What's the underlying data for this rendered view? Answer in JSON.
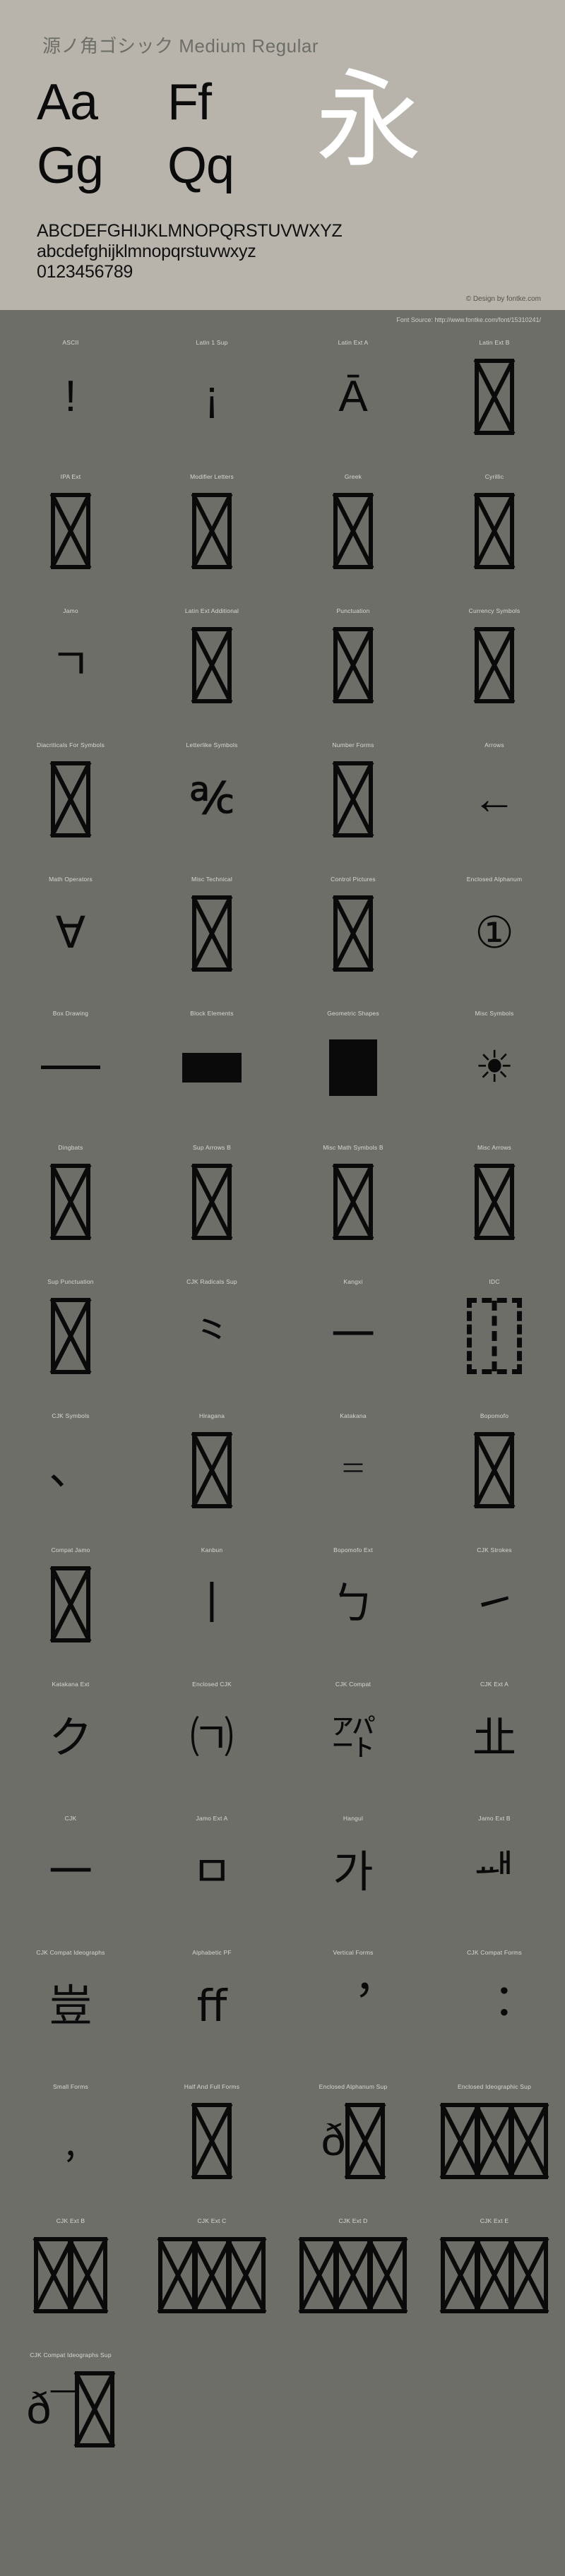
{
  "specimen": {
    "title": "源ノ角ゴシック Medium Regular",
    "samples": [
      {
        "upper": "Aa",
        "lower": "Gg"
      },
      {
        "upper": "Ff",
        "lower": "Qq"
      }
    ],
    "cjk_sample": "永",
    "uppercase": "ABCDEFGHIJKLMNOPQRSTUVWXYZ",
    "lowercase": "abcdefghijklmnopqrstuvwxyz",
    "digits": "0123456789",
    "credit": "© Design by fontke.com",
    "source": "Font Source: http://www.fontke.com/font/15310241/",
    "colors": {
      "panel_bg": "#b8b4ab",
      "page_bg": "#6e6e69",
      "glyph_black": "#0a0a0a",
      "glyph_white": "#ffffff",
      "label_grey": "#d9d7d2"
    }
  },
  "blocks": [
    [
      {
        "label": "ASCII",
        "glyph": "!",
        "kind": "text"
      },
      {
        "label": "Latin 1 Sup",
        "glyph": "¡",
        "kind": "text"
      },
      {
        "label": "Latin Ext A",
        "glyph": "Ā",
        "kind": "text"
      },
      {
        "label": "Latin Ext B",
        "glyph": "",
        "kind": "notdef"
      }
    ],
    [
      {
        "label": "IPA Ext",
        "glyph": "",
        "kind": "notdef"
      },
      {
        "label": "Modifier Letters",
        "glyph": "",
        "kind": "notdef"
      },
      {
        "label": "Greek",
        "glyph": "",
        "kind": "notdef"
      },
      {
        "label": "Cyrillic",
        "glyph": "",
        "kind": "notdef"
      }
    ],
    [
      {
        "label": "Jamo",
        "glyph": "ㄱ",
        "kind": "text"
      },
      {
        "label": "Latin Ext Additional",
        "glyph": "",
        "kind": "notdef"
      },
      {
        "label": "Punctuation",
        "glyph": "",
        "kind": "notdef"
      },
      {
        "label": "Currency Symbols",
        "glyph": "",
        "kind": "notdef"
      }
    ],
    [
      {
        "label": "Diacriticals For Symbols",
        "glyph": "",
        "kind": "notdef"
      },
      {
        "label": "Letterlike Symbols",
        "glyph": "℀",
        "kind": "text"
      },
      {
        "label": "Number Forms",
        "glyph": "",
        "kind": "notdef"
      },
      {
        "label": "Arrows",
        "glyph": "←",
        "kind": "text"
      }
    ],
    [
      {
        "label": "Math Operators",
        "glyph": "∀",
        "kind": "text"
      },
      {
        "label": "Misc Technical",
        "glyph": "",
        "kind": "notdef"
      },
      {
        "label": "Control Pictures",
        "glyph": "",
        "kind": "notdef"
      },
      {
        "label": "Enclosed Alphanum",
        "glyph": "①",
        "kind": "text"
      }
    ],
    [
      {
        "label": "Box Drawing",
        "glyph": "─",
        "kind": "boxline"
      },
      {
        "label": "Block Elements",
        "glyph": "▀",
        "kind": "blockrect"
      },
      {
        "label": "Geometric Shapes",
        "glyph": "▮",
        "kind": "georect"
      },
      {
        "label": "Misc Symbols",
        "glyph": "☀",
        "kind": "text"
      }
    ],
    [
      {
        "label": "Dingbats",
        "glyph": "",
        "kind": "notdef"
      },
      {
        "label": "Sup Arrows B",
        "glyph": "",
        "kind": "notdef"
      },
      {
        "label": "Misc Math Symbols B",
        "glyph": "",
        "kind": "notdef"
      },
      {
        "label": "Misc Arrows",
        "glyph": "",
        "kind": "notdef"
      }
    ],
    [
      {
        "label": "Sup Punctuation",
        "glyph": "",
        "kind": "notdef"
      },
      {
        "label": "CJK Radicals Sup",
        "glyph": "⺀",
        "kind": "text"
      },
      {
        "label": "Kangxi",
        "glyph": "一",
        "kind": "text"
      },
      {
        "label": "IDC",
        "glyph": "",
        "kind": "notdef-dashed"
      }
    ],
    [
      {
        "label": "CJK Symbols",
        "glyph": "、",
        "kind": "text"
      },
      {
        "label": "Hiragana",
        "glyph": "",
        "kind": "notdef"
      },
      {
        "label": "Katakana",
        "glyph": "゠",
        "kind": "text"
      },
      {
        "label": "Bopomofo",
        "glyph": "",
        "kind": "notdef"
      }
    ],
    [
      {
        "label": "Compat Jamo",
        "glyph": "",
        "kind": "notdef"
      },
      {
        "label": "Kanbun",
        "glyph": "丨",
        "kind": "text"
      },
      {
        "label": "Bopomofo Ext",
        "glyph": "ㄅ",
        "kind": "text"
      },
      {
        "label": "CJK Strokes",
        "glyph": "㇀",
        "kind": "text"
      }
    ],
    [
      {
        "label": "Katakana Ext",
        "glyph": "ク",
        "kind": "text"
      },
      {
        "label": "Enclosed CJK",
        "glyph": "㈀",
        "kind": "text"
      },
      {
        "label": "CJK Compat",
        "glyph": "㌀",
        "kind": "text"
      },
      {
        "label": "CJK Ext A",
        "glyph": "㐀",
        "kind": "text"
      }
    ],
    [
      {
        "label": "CJK",
        "glyph": "一",
        "kind": "text"
      },
      {
        "label": "Jamo Ext A",
        "glyph": "ㅁ",
        "kind": "text"
      },
      {
        "label": "Hangul",
        "glyph": "가",
        "kind": "text"
      },
      {
        "label": "Jamo Ext B",
        "glyph": "ힳ",
        "kind": "text"
      }
    ],
    [
      {
        "label": "CJK Compat Ideographs",
        "glyph": "豈",
        "kind": "text"
      },
      {
        "label": "Alphabetic PF",
        "glyph": "ﬀ",
        "kind": "text"
      },
      {
        "label": "Vertical Forms",
        "glyph": "︐",
        "kind": "text"
      },
      {
        "label": "CJK Compat Forms",
        "glyph": "︓",
        "kind": "text"
      }
    ],
    [
      {
        "label": "Small Forms",
        "glyph": "﹐",
        "kind": "text"
      },
      {
        "label": "Half And Full Forms",
        "glyph": "",
        "kind": "notdef"
      },
      {
        "label": "Enclosed Alphanum Sup",
        "glyph": "🄀",
        "kind": "surrogate1"
      },
      {
        "label": "Enclosed Ideographic Sup",
        "glyph": "🈀",
        "kind": "surrogate3"
      }
    ],
    [
      {
        "label": "CJK Ext B",
        "glyph": "",
        "kind": "surrogate2"
      },
      {
        "label": "CJK Ext C",
        "glyph": "",
        "kind": "surrogate4"
      },
      {
        "label": "CJK Ext D",
        "glyph": "",
        "kind": "surrogate4"
      },
      {
        "label": "CJK Ext E",
        "glyph": "",
        "kind": "surrogate4"
      }
    ],
    [
      {
        "label": "CJK Compat Ideographs Sup",
        "glyph": "",
        "kind": "surrogate5"
      }
    ]
  ]
}
